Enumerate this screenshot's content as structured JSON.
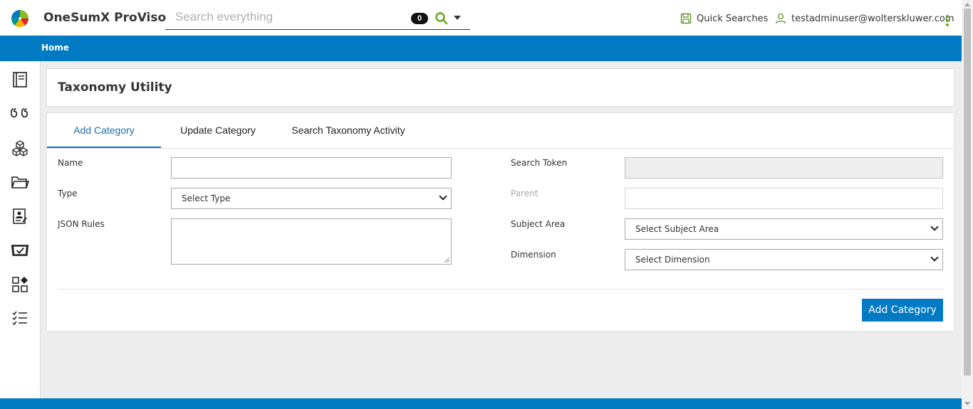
{
  "header": {
    "app_title": "OneSumX ProViso",
    "search_placeholder": "Search everything",
    "search_count": "0",
    "quick_searches_label": "Quick Searches",
    "user_email": "testadminuser@wolterskluwer.com"
  },
  "breadcrumb": {
    "home": "Home"
  },
  "sidebar": {
    "items": [
      {
        "icon": "notebook-icon"
      },
      {
        "icon": "quote-icon"
      },
      {
        "icon": "cubes-icon"
      },
      {
        "icon": "folder-icon"
      },
      {
        "icon": "user-document-icon"
      },
      {
        "icon": "checked-tray-icon"
      },
      {
        "icon": "apps-grid-icon"
      },
      {
        "icon": "checklist-icon"
      }
    ]
  },
  "page": {
    "title": "Taxonomy Utility"
  },
  "tabs": [
    "Add Category",
    "Update Category",
    "Search Taxonomy Activity"
  ],
  "form": {
    "name_label": "Name",
    "name_value": "",
    "type_label": "Type",
    "type_selected": "Select Type",
    "json_rules_label": "JSON Rules",
    "json_rules_value": "",
    "search_token_label": "Search Token",
    "search_token_value": "",
    "parent_label": "Parent",
    "parent_value": "",
    "subject_area_label": "Subject Area",
    "subject_area_selected": "Select Subject Area",
    "dimension_label": "Dimension",
    "dimension_selected": "Select Dimension",
    "submit_label": "Add Category"
  },
  "colors": {
    "brand_blue": "#007ac3",
    "accent_green": "#66a31d",
    "tab_active": "#1a6db3"
  }
}
